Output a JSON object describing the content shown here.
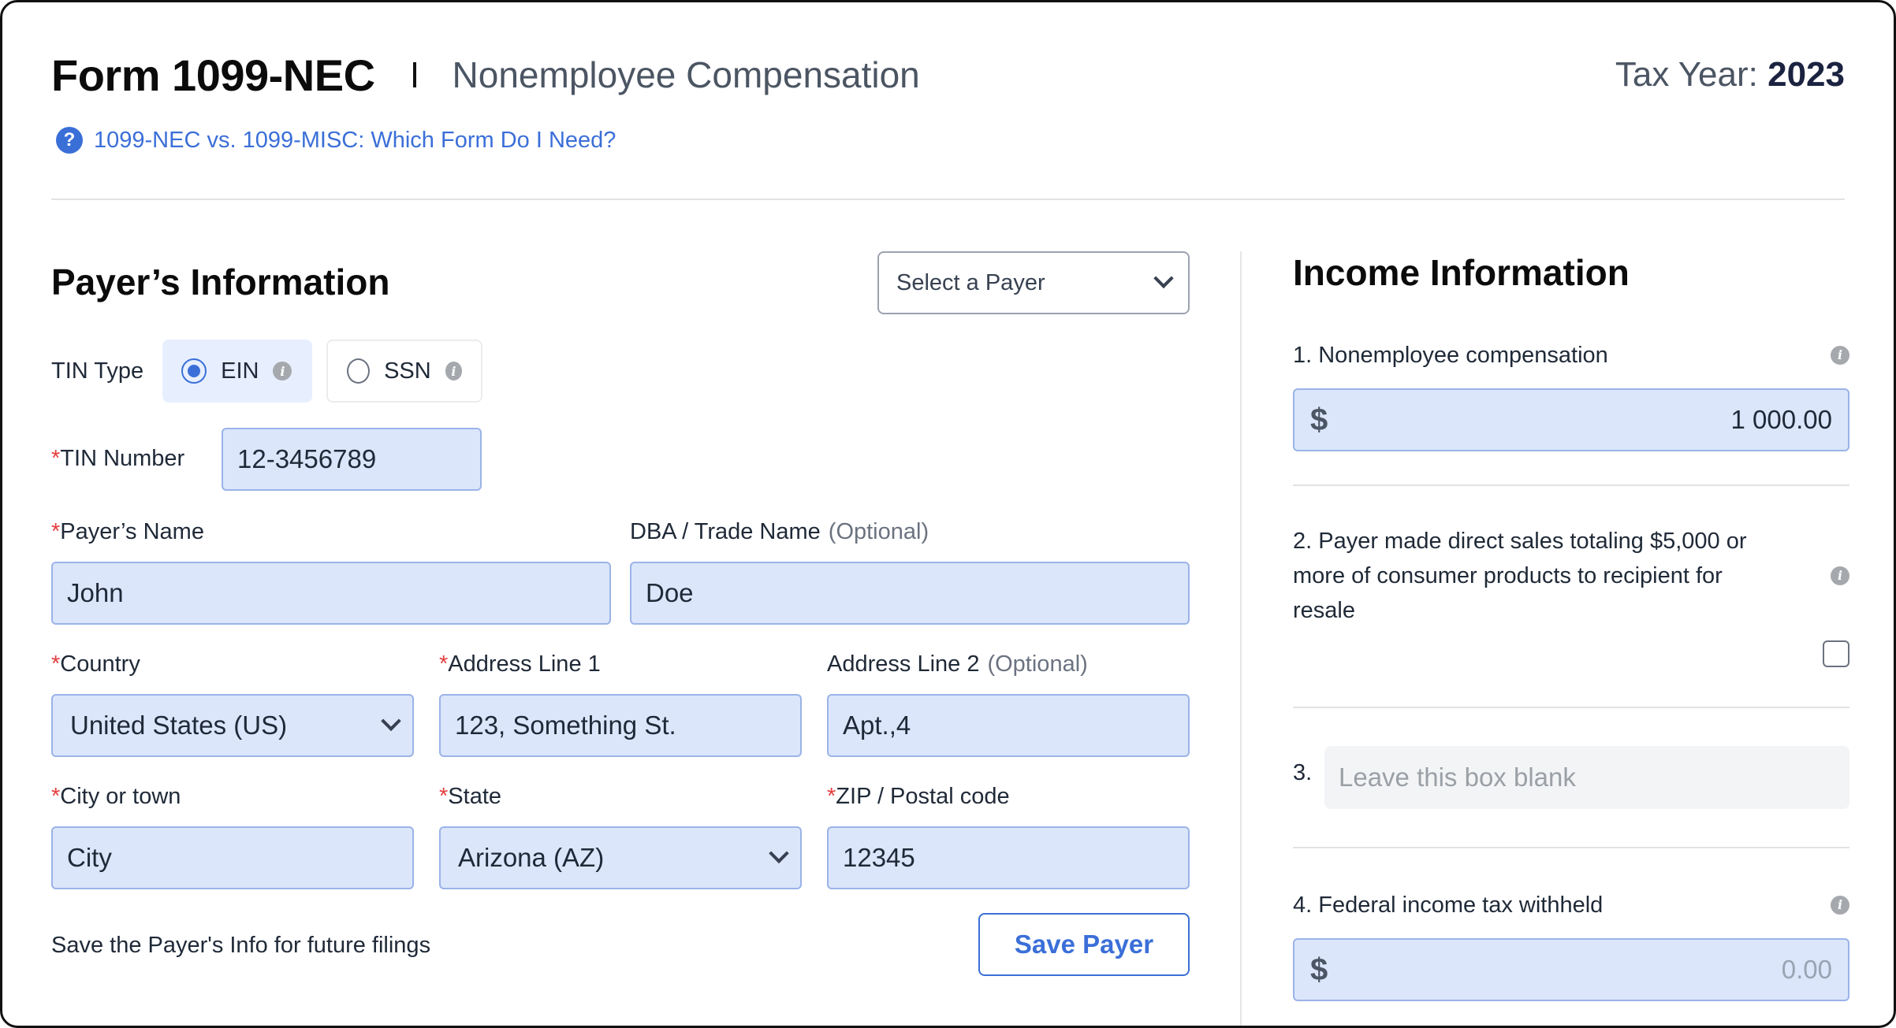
{
  "header": {
    "title": "Form 1099-NEC",
    "subtitle": "Nonemployee Compensation",
    "tax_year_label": "Tax Year:",
    "tax_year": "2023",
    "help_link": "1099-NEC vs. 1099-MISC: Which Form Do I Need?",
    "help_icon": "?"
  },
  "payer": {
    "section_title": "Payer’s Information",
    "select_payer": "Select a Payer",
    "tin_type_label": "TIN Type",
    "tin_options": [
      {
        "label": "EIN",
        "selected": true
      },
      {
        "label": "SSN",
        "selected": false
      }
    ],
    "required_mark": "*",
    "optional_text": "(Optional)",
    "tin_number_label": "TIN Number",
    "tin_number": "12-3456789",
    "name_label": "Payer’s Name",
    "name": "John",
    "dba_label": "DBA / Trade Name",
    "dba": "Doe",
    "country_label": "Country",
    "country": "United States (US)",
    "address1_label": "Address Line 1",
    "address1": "123, Something St.",
    "address2_label": "Address Line 2",
    "address2": "Apt.,4",
    "city_label": "City or town",
    "city": "City",
    "state_label": "State",
    "state": "Arizona (AZ)",
    "zip_label": "ZIP / Postal code",
    "zip": "12345",
    "save_note": "Save the Payer's Info for future filings",
    "save_button": "Save Payer"
  },
  "income": {
    "section_title": "Income Information",
    "box1_label": "1. Nonemployee compensation",
    "box1_currency": "$",
    "box1_value": "1 000.00",
    "box2_label": "2. Payer made direct sales totaling $5,000 or more of consumer products to recipient for resale",
    "box2_checked": false,
    "box3_number": "3.",
    "box3_placeholder": "Leave this box blank",
    "box4_label": "4. Federal income tax withheld",
    "box4_currency": "$",
    "box4_placeholder": "0.00",
    "info_icon": "i"
  },
  "colors": {
    "accent": "#3b6fd8",
    "input_fill": "#dbe6fb",
    "required": "#e53e3e"
  }
}
